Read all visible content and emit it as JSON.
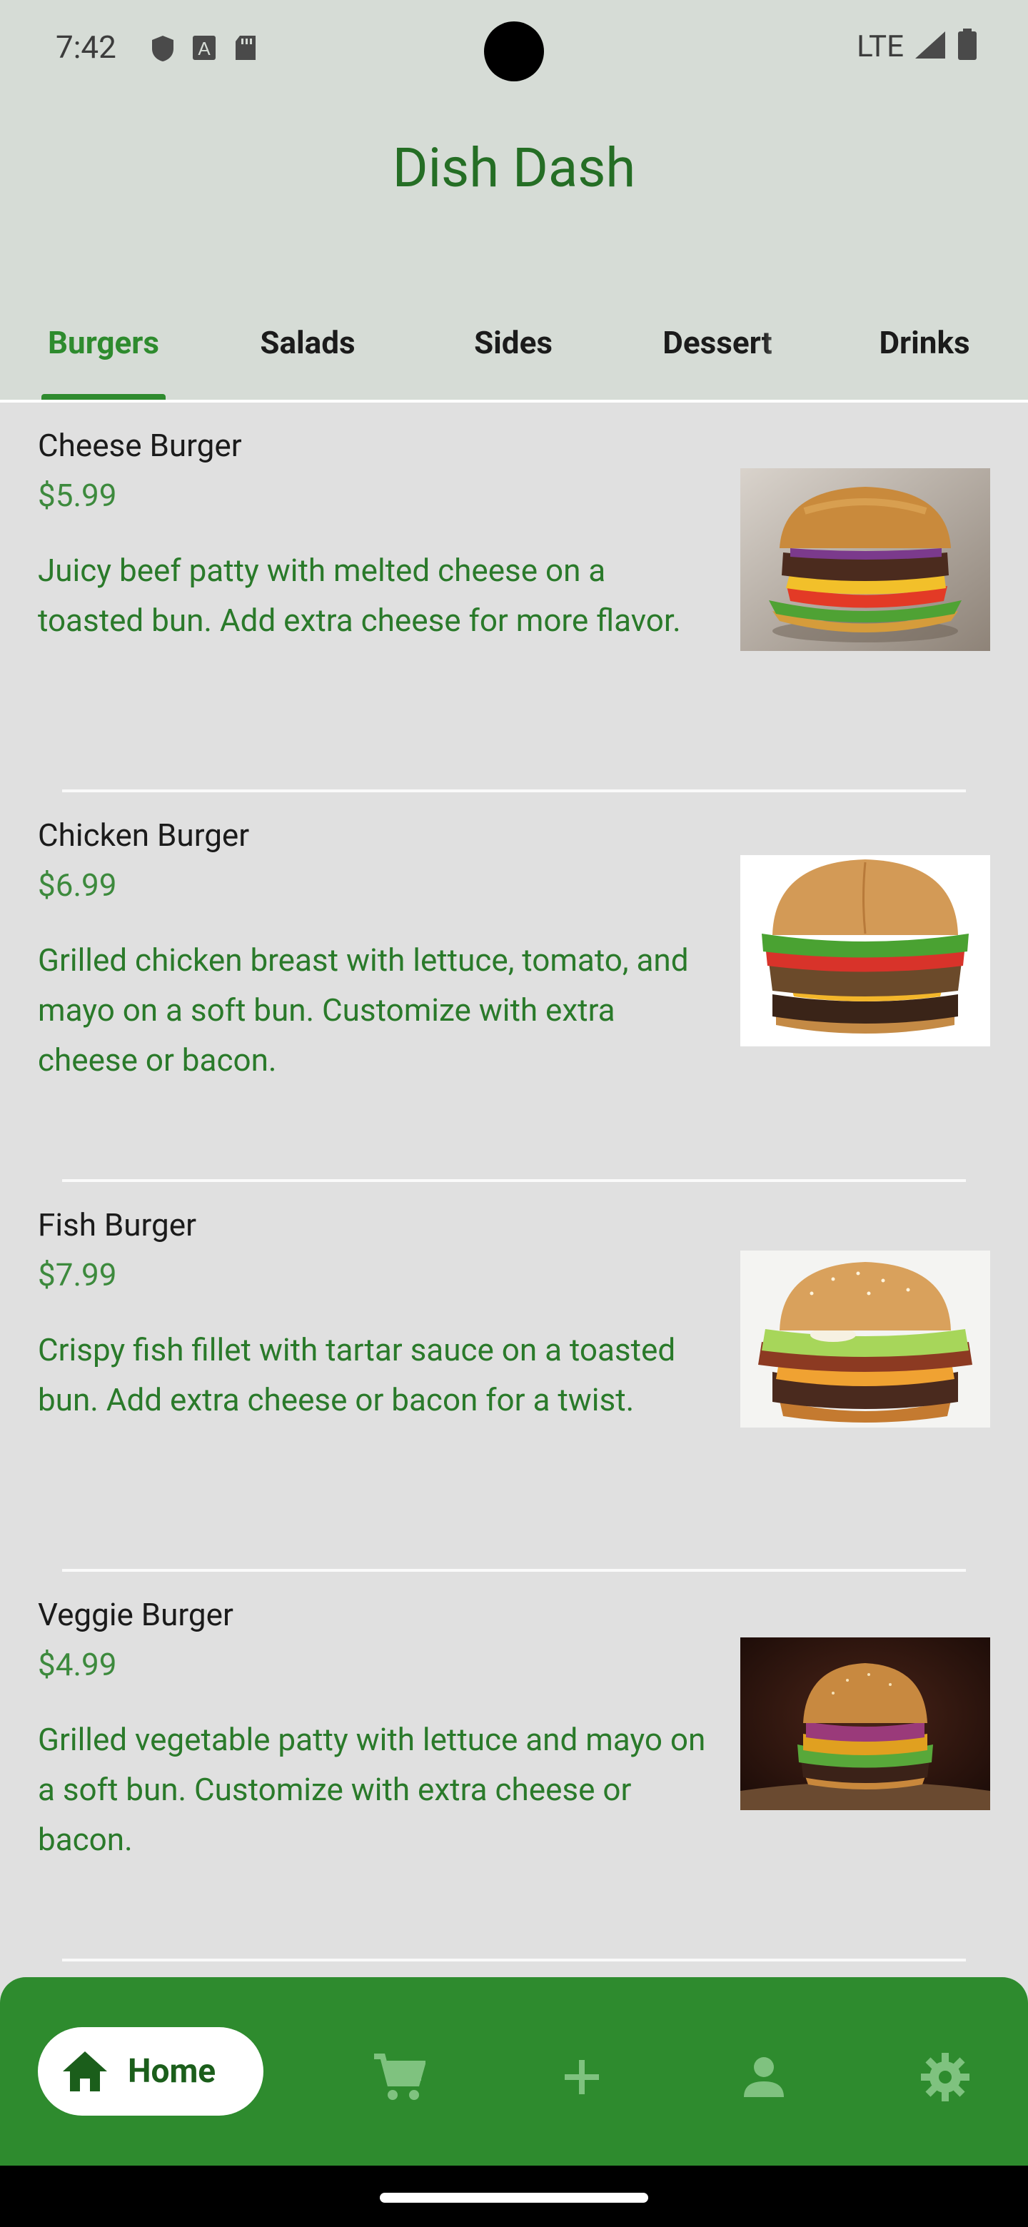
{
  "status": {
    "time": "7:42",
    "network": "LTE",
    "left_icons": [
      "shield-icon",
      "text-a-icon",
      "sd-card-icon"
    ],
    "right_icons": [
      "signal-icon",
      "battery-icon"
    ]
  },
  "app": {
    "title": "Dish Dash",
    "colors": {
      "primary": "#2e8b2e",
      "title": "#256e25",
      "background": "#e0e0e0",
      "header": "#d6dcd6"
    }
  },
  "tabs": [
    {
      "label": "Burgers",
      "active": true
    },
    {
      "label": "Salads",
      "active": false
    },
    {
      "label": "Sides",
      "active": false
    },
    {
      "label": "Dessert",
      "active": false
    },
    {
      "label": "Drinks",
      "active": false
    }
  ],
  "menu_items": [
    {
      "name": "Cheese Burger",
      "price": "$5.99",
      "description": "Juicy beef patty with melted cheese on a toasted bun. Add extra cheese for more flavor.",
      "image": "cheese-burger-photo"
    },
    {
      "name": "Chicken Burger",
      "price": "$6.99",
      "description": "Grilled chicken breast with lettuce, tomato, and mayo on a soft bun. Customize with extra cheese or bacon.",
      "image": "chicken-burger-photo"
    },
    {
      "name": "Fish Burger",
      "price": "$7.99",
      "description": "Crispy fish fillet with tartar sauce on a toasted bun. Add extra cheese or bacon for a twist.",
      "image": "fish-burger-photo"
    },
    {
      "name": "Veggie Burger",
      "price": "$4.99",
      "description": "Grilled vegetable patty with lettuce and mayo on a soft bun. Customize with extra cheese or bacon.",
      "image": "veggie-burger-photo"
    }
  ],
  "bottom_nav": {
    "home_label": "Home",
    "icons": [
      "home-icon",
      "cart-icon",
      "add-icon",
      "person-icon",
      "settings-icon"
    ]
  }
}
